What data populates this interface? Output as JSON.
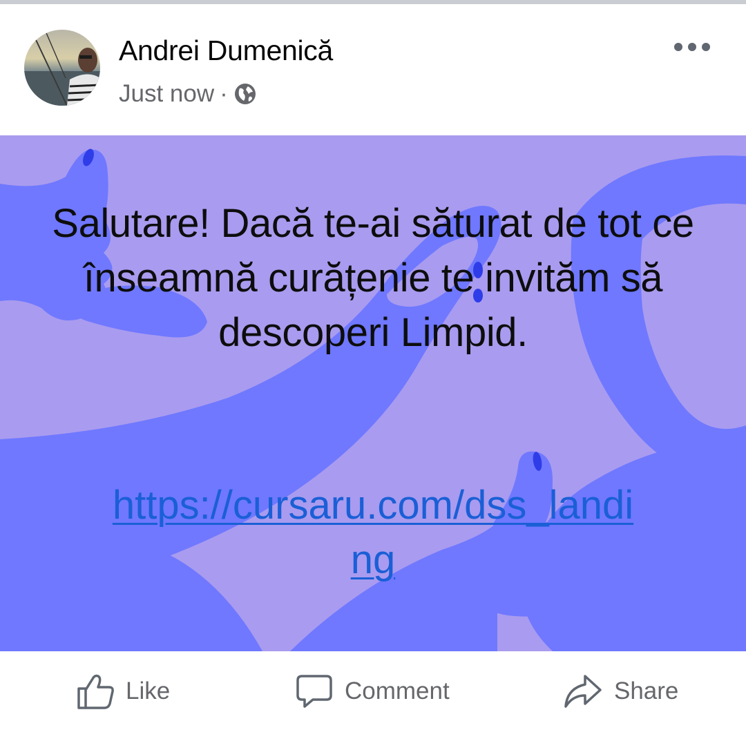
{
  "post": {
    "author": "Andrei Dumenică",
    "timestamp": "Just now",
    "separator": "·",
    "privacy_icon": "globe-icon",
    "more_icon": "more-options-icon",
    "body_text": "Salutare! Dacă te-ai săturat de tot ce înseamnă curățenie te invităm să descoperi Limpid.",
    "link_text": "https://cursaru.com/dss_landing",
    "card_colors": {
      "background": "#a99bef",
      "shapes": "#6f78ff",
      "accent": "#2f3de8"
    }
  },
  "actions": {
    "like_label": "Like",
    "comment_label": "Comment",
    "share_label": "Share"
  }
}
